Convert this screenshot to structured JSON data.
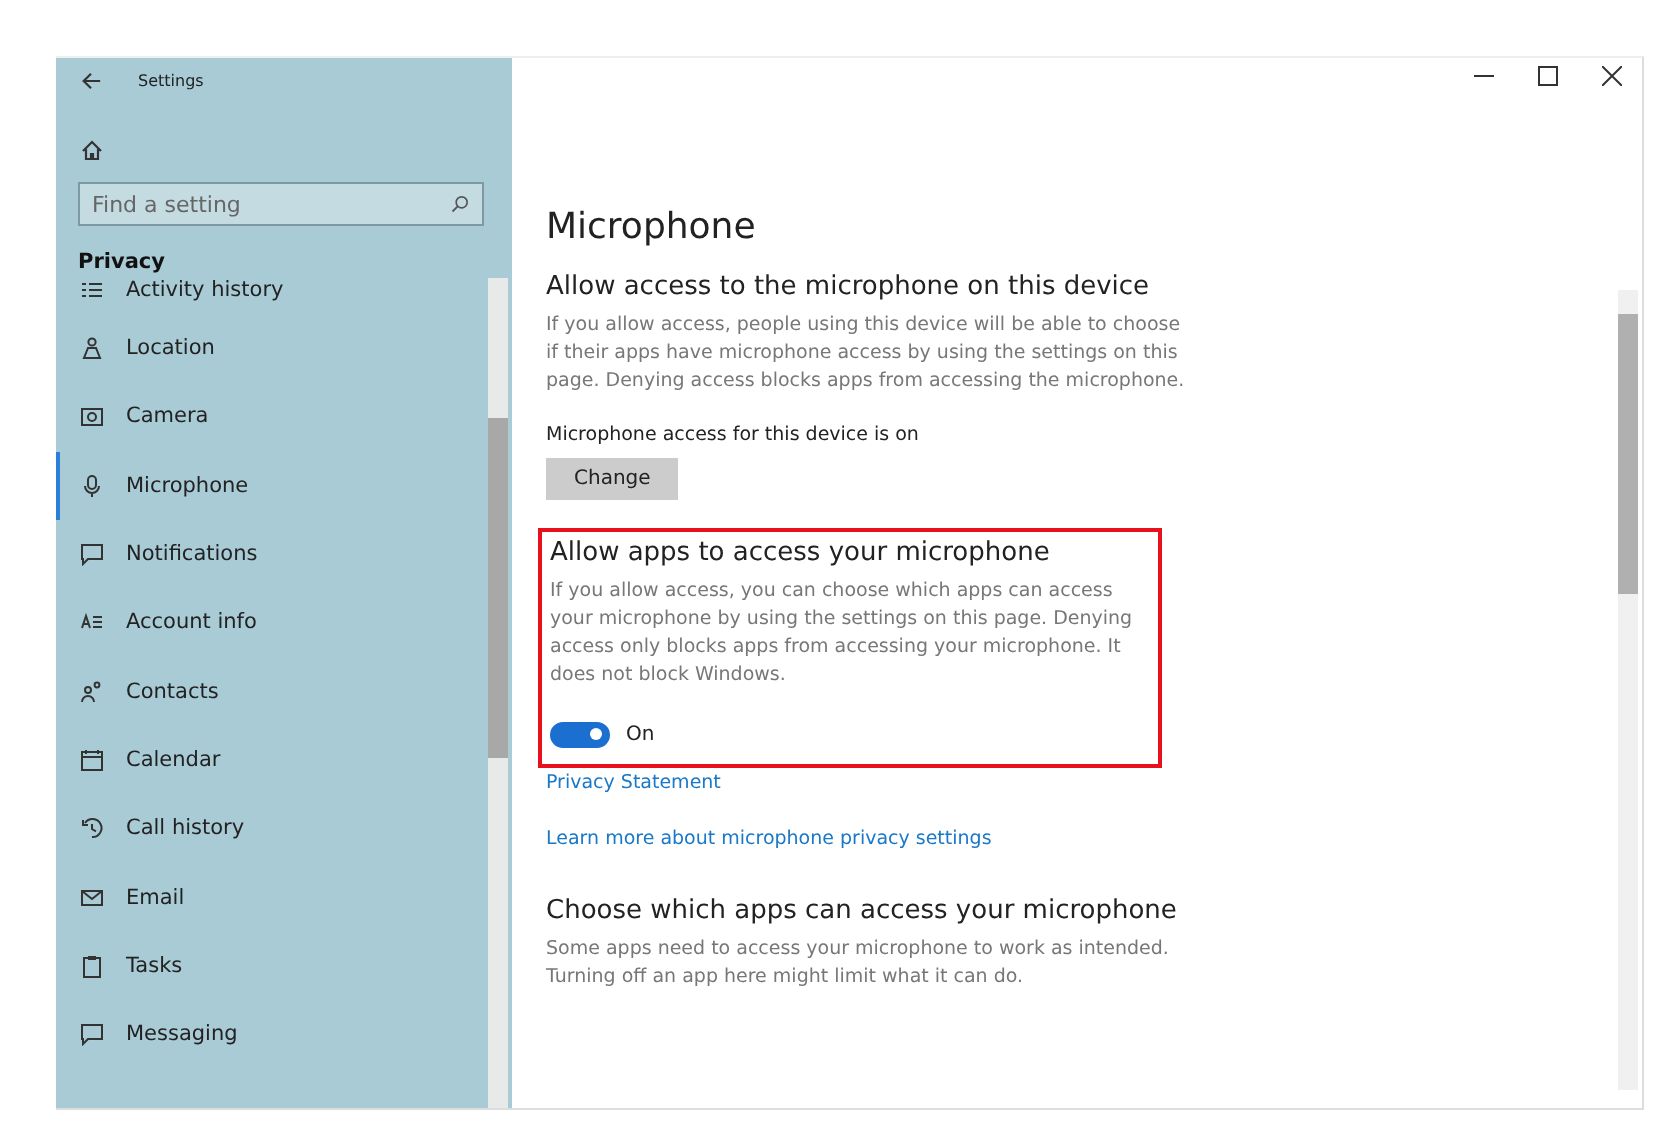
{
  "window": {
    "title": "Settings"
  },
  "sidebar": {
    "search": {
      "placeholder": "Find a setting"
    },
    "section": "Privacy",
    "items": [
      {
        "label": "Activity history",
        "selected": false
      },
      {
        "label": "Location",
        "selected": false
      },
      {
        "label": "Camera",
        "selected": false
      },
      {
        "label": "Microphone",
        "selected": true
      },
      {
        "label": "Notifications",
        "selected": false
      },
      {
        "label": "Account info",
        "selected": false
      },
      {
        "label": "Contacts",
        "selected": false
      },
      {
        "label": "Calendar",
        "selected": false
      },
      {
        "label": "Call history",
        "selected": false
      },
      {
        "label": "Email",
        "selected": false
      },
      {
        "label": "Tasks",
        "selected": false
      },
      {
        "label": "Messaging",
        "selected": false
      }
    ]
  },
  "main": {
    "title": "Microphone",
    "sections": [
      {
        "kind": "device",
        "heading": "Allow access to the microphone on this device",
        "description": "If you allow access, people using this device will be able to choose if their apps have microphone access by using the settings on this page. Denying access blocks apps from accessing the microphone.",
        "status": "Microphone access for this device is on",
        "button": "Change",
        "highlighted": false
      },
      {
        "kind": "toggle",
        "heading": "Allow apps to access your microphone",
        "description": "If you allow access, you can choose which apps can access your microphone by using the settings on this page. Denying access only blocks apps from accessing your microphone. It does not block Windows.",
        "toggle": {
          "on": true,
          "label": "On"
        },
        "highlighted": true
      },
      {
        "kind": "links",
        "links": [
          "Privacy Statement",
          "Learn more about microphone privacy settings"
        ]
      },
      {
        "kind": "text",
        "heading": "Choose which apps can access your microphone",
        "description": "Some apps need to access your microphone to work as intended. Turning off an app here might limit what it can do.",
        "highlighted": false
      }
    ]
  }
}
